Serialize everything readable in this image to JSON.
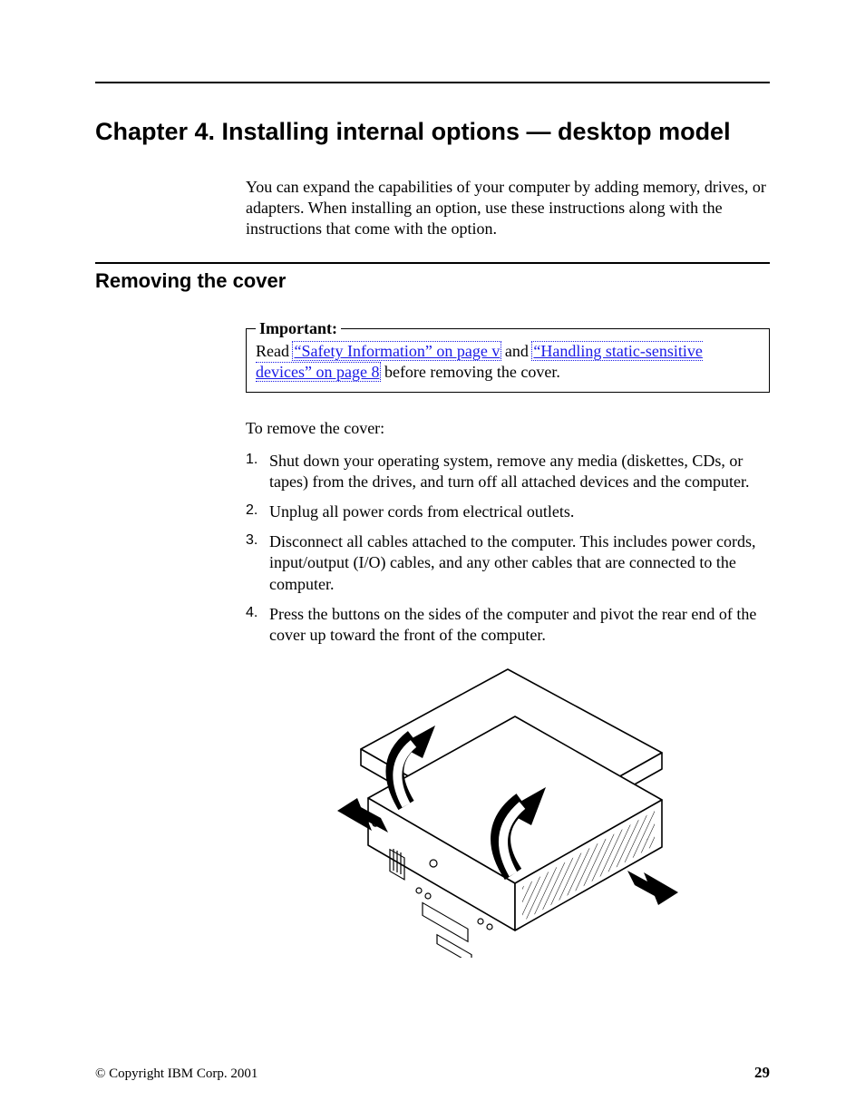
{
  "chapter": {
    "title": "Chapter 4. Installing internal options — desktop model",
    "intro": "You can expand the capabilities of your computer by adding memory, drives, or adapters. When installing an option, use these instructions along with the instructions that come with the option."
  },
  "section": {
    "title": "Removing the cover",
    "important": {
      "legend": "Important:",
      "before": "Read ",
      "link1": "“Safety Information” on page v",
      "mid": " and ",
      "link2": "“Handling static-sensitive devices” on page 8",
      "after": " before removing the cover."
    },
    "lead": "To remove the cover:",
    "steps": [
      "Shut down your operating system, remove any media (diskettes, CDs, or tapes) from the drives, and turn off all attached devices and the computer.",
      "Unplug all power cords from electrical outlets.",
      "Disconnect all cables attached to the computer. This includes power cords, input/output (I/O) cables, and any other cables that are connected to the computer.",
      "Press the buttons on the sides of the computer and pivot the rear end of the cover up toward the front of the computer."
    ]
  },
  "footer": {
    "copyright": "© Copyright IBM Corp. 2001",
    "page_number": "29"
  }
}
